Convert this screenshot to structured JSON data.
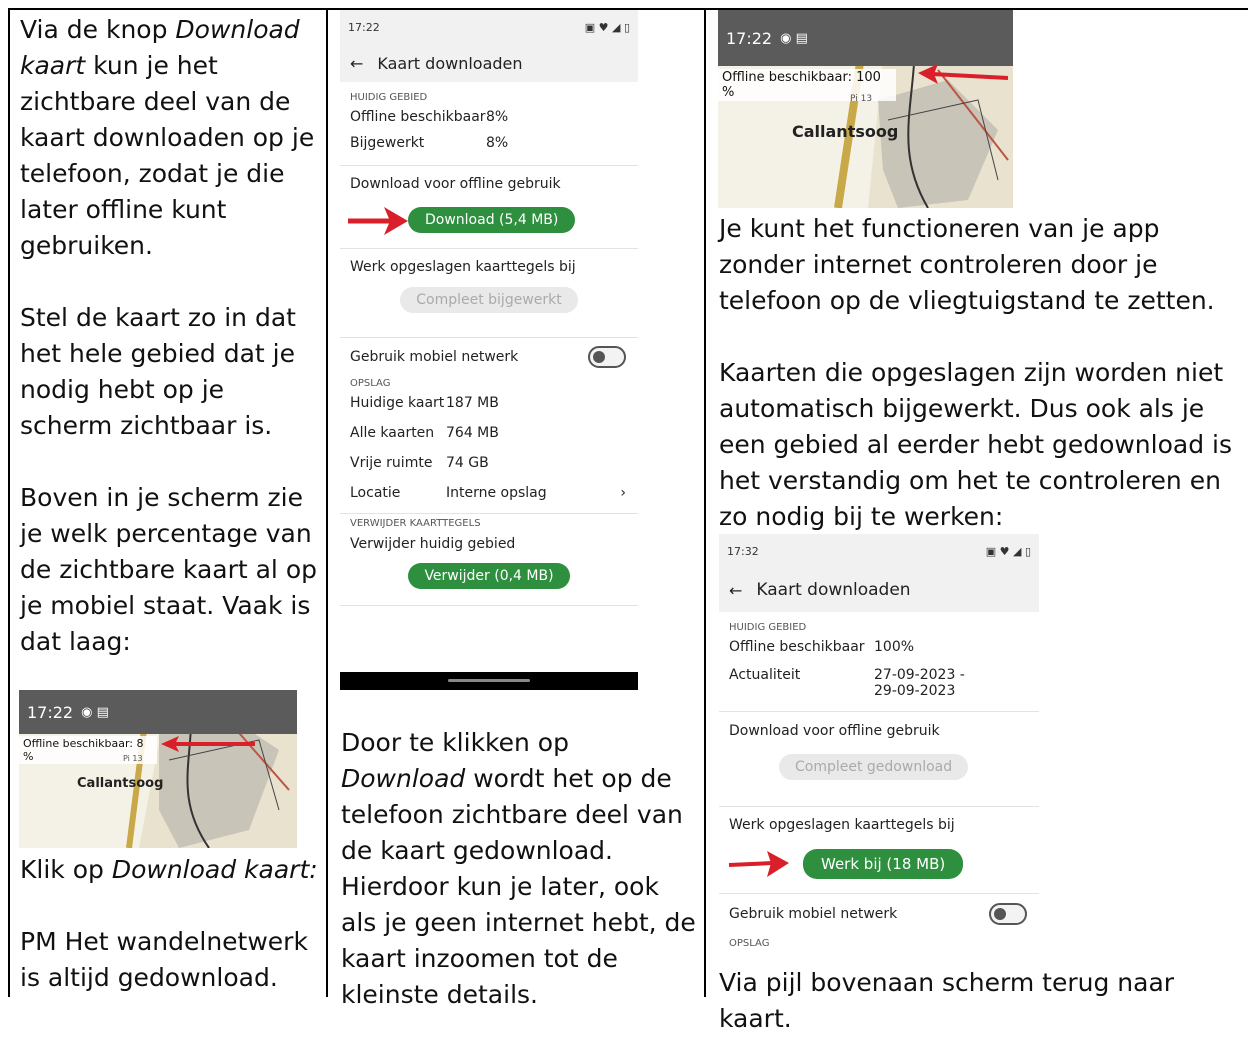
{
  "col1": {
    "p1_a": "Via de knop ",
    "p1_i": "Download kaart",
    "p1_b": " kun je het zichtbare deel van de kaart downloaden op je telefoon, zodat je die later offline kunt gebruiken.",
    "p2": "Stel de kaart zo in dat het hele gebied dat je nodig hebt op je scherm zichtbaar is.",
    "p3": "Boven in je scherm zie je welk percentage van de zichtbare kaart al op je mobiel staat. Vaak is dat laag:",
    "map_time": "17:22",
    "map_offline": "Offline beschikbaar: 8 %",
    "map_place": "Callantsoog",
    "map_small": "Pi 13",
    "p4_a": "Klik op ",
    "p4_i": "Download kaart:",
    "p5": "PM Het wandelnetwerk is altijd gedownload."
  },
  "col2": {
    "shot": {
      "time": "17:22",
      "title": "Kaart downloaden",
      "sect1": "HUIDIG GEBIED",
      "offline_k": "Offline beschikbaar",
      "offline_v": "8%",
      "updated_k": "Bijgewerkt",
      "updated_v": "8%",
      "download_hdr": "Download voor offline gebruik",
      "download_btn": "Download (5,4 MB)",
      "update_hdr": "Werk opgeslagen kaarttegels bij",
      "update_btn": "Compleet bijgewerkt",
      "mobile": "Gebruik mobiel netwerk",
      "sect2": "OPSLAG",
      "cur_k": "Huidige kaart",
      "cur_v": "187 MB",
      "all_k": "Alle kaarten",
      "all_v": "764 MB",
      "free_k": "Vrije ruimte",
      "free_v": "74 GB",
      "loc_k": "Locatie",
      "loc_v": "Interne opslag",
      "sect3": "VERWIJDER KAARTTEGELS",
      "del_hdr": "Verwijder huidig gebied",
      "del_btn": "Verwijder (0,4 MB)"
    },
    "p1_a": "Door te klikken op ",
    "p1_i": "Download",
    "p1_b": " wordt het op de telefoon zichtbare deel van de kaart gedownload. Hierdoor kun je later, ook als je geen internet hebt, de kaart inzoomen tot de kleinste details."
  },
  "col3": {
    "map_time": "17:22",
    "map_offline": "Offline beschikbaar: 100 %",
    "map_place": "Callantsoog",
    "map_small": "Pi 13",
    "p1": "Je kunt het functioneren van je app zonder internet controleren door je telefoon op de vliegtuigstand te zetten.",
    "p2": "Kaarten die opgeslagen zijn worden niet automatisch bijgewerkt. Dus ook als je een gebied al eerder hebt gedownload is het verstandig om het te controleren en zo nodig bij te werken:",
    "shot": {
      "time": "17:32",
      "title": "Kaart downloaden",
      "sect1": "HUIDIG GEBIED",
      "offline_k": "Offline beschikbaar",
      "offline_v": "100%",
      "act_k": "Actualiteit",
      "act_v1": "27-09-2023 -",
      "act_v2": "29-09-2023",
      "download_hdr": "Download voor offline gebruik",
      "download_btn": "Compleet gedownload",
      "update_hdr": "Werk opgeslagen kaarttegels bij",
      "update_btn": "Werk bij (18 MB)",
      "mobile": "Gebruik mobiel netwerk",
      "sect2": "OPSLAG"
    },
    "p3": "Via pijl bovenaan scherm terug naar kaart."
  },
  "colors": {
    "green": "#2e8f3e",
    "red": "#d9202a"
  }
}
